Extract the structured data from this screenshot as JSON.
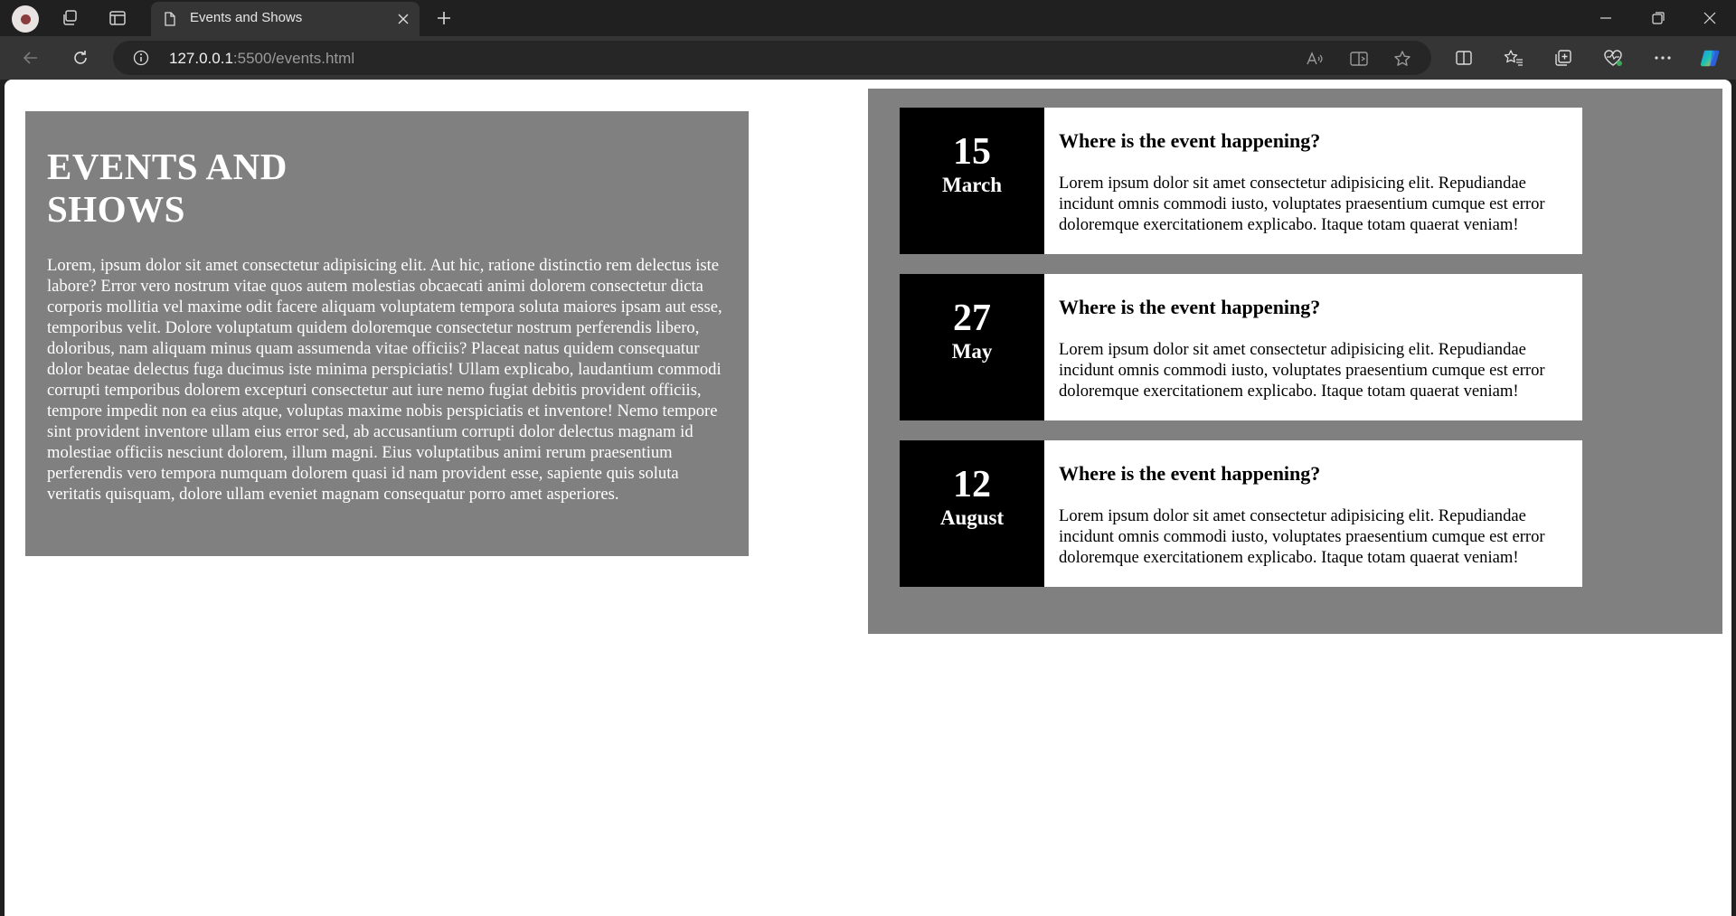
{
  "browser": {
    "tab_title": "Events and Shows",
    "url_host": "127.0.0.1",
    "url_path": ":5500/events.html"
  },
  "page": {
    "intro": {
      "heading": "EVENTS AND SHOWS",
      "body": "Lorem, ipsum dolor sit amet consectetur adipisicing elit. Aut hic, ratione distinctio rem delectus iste labore? Error vero nostrum vitae quos autem molestias obcaecati animi dolorem consectetur dicta corporis mollitia vel maxime odit facere aliquam voluptatem tempora soluta maiores ipsam aut esse, temporibus velit. Dolore voluptatum quidem doloremque consectetur nostrum perferendis libero, doloribus, nam aliquam minus quam assumenda vitae officiis? Placeat natus quidem consequatur dolor beatae delectus fuga ducimus iste minima perspiciatis! Ullam explicabo, laudantium commodi corrupti temporibus dolorem excepturi consectetur aut iure nemo fugiat debitis provident officiis, tempore impedit non ea eius atque, voluptas maxime nobis perspiciatis et inventore! Nemo tempore sint provident inventore ullam eius error sed, ab accusantium corrupti dolor delectus magnam id molestiae officiis nesciunt dolorem, illum magni. Eius voluptatibus animi rerum praesentium perferendis vero tempora numquam dolorem quasi id nam provident esse, sapiente quis soluta veritatis quisquam, dolore ullam eveniet magnam consequatur porro amet asperiores."
    },
    "events": [
      {
        "day": "15",
        "month": "March",
        "title": "Where is the event happening?",
        "description": "Lorem ipsum dolor sit amet consectetur adipisicing elit. Repudiandae incidunt omnis commodi iusto, voluptates praesentium cumque est error doloremque exercitationem explicabo. Itaque totam quaerat veniam!"
      },
      {
        "day": "27",
        "month": "May",
        "title": "Where is the event happening?",
        "description": "Lorem ipsum dolor sit amet consectetur adipisicing elit. Repudiandae incidunt omnis commodi iusto, voluptates praesentium cumque est error doloremque exercitationem explicabo. Itaque totam quaerat veniam!"
      },
      {
        "day": "12",
        "month": "August",
        "title": "Where is the event happening?",
        "description": "Lorem ipsum dolor sit amet consectetur adipisicing elit. Repudiandae incidunt omnis commodi iusto, voluptates praesentium cumque est error doloremque exercitationem explicabo. Itaque totam quaerat veniam!"
      }
    ]
  },
  "colors": {
    "panel_gray": "#808080",
    "date_black": "#000000",
    "chrome_dark": "#202020",
    "chrome_toolbar": "#353535"
  },
  "icons": {
    "tabbar": [
      "profile-avatar-icon",
      "workspaces-icon",
      "tab-actions-icon",
      "page-icon",
      "close-icon",
      "new-tab-icon"
    ],
    "window": [
      "minimize-icon",
      "restore-icon",
      "close-window-icon"
    ],
    "toolbar": [
      "back-icon",
      "refresh-icon",
      "info-icon",
      "read-aloud-icon",
      "immersive-reader-icon",
      "favorite-star-icon",
      "split-screen-icon",
      "favorites-icon",
      "collections-icon",
      "browser-essentials-icon",
      "more-icon",
      "copilot-icon"
    ]
  }
}
